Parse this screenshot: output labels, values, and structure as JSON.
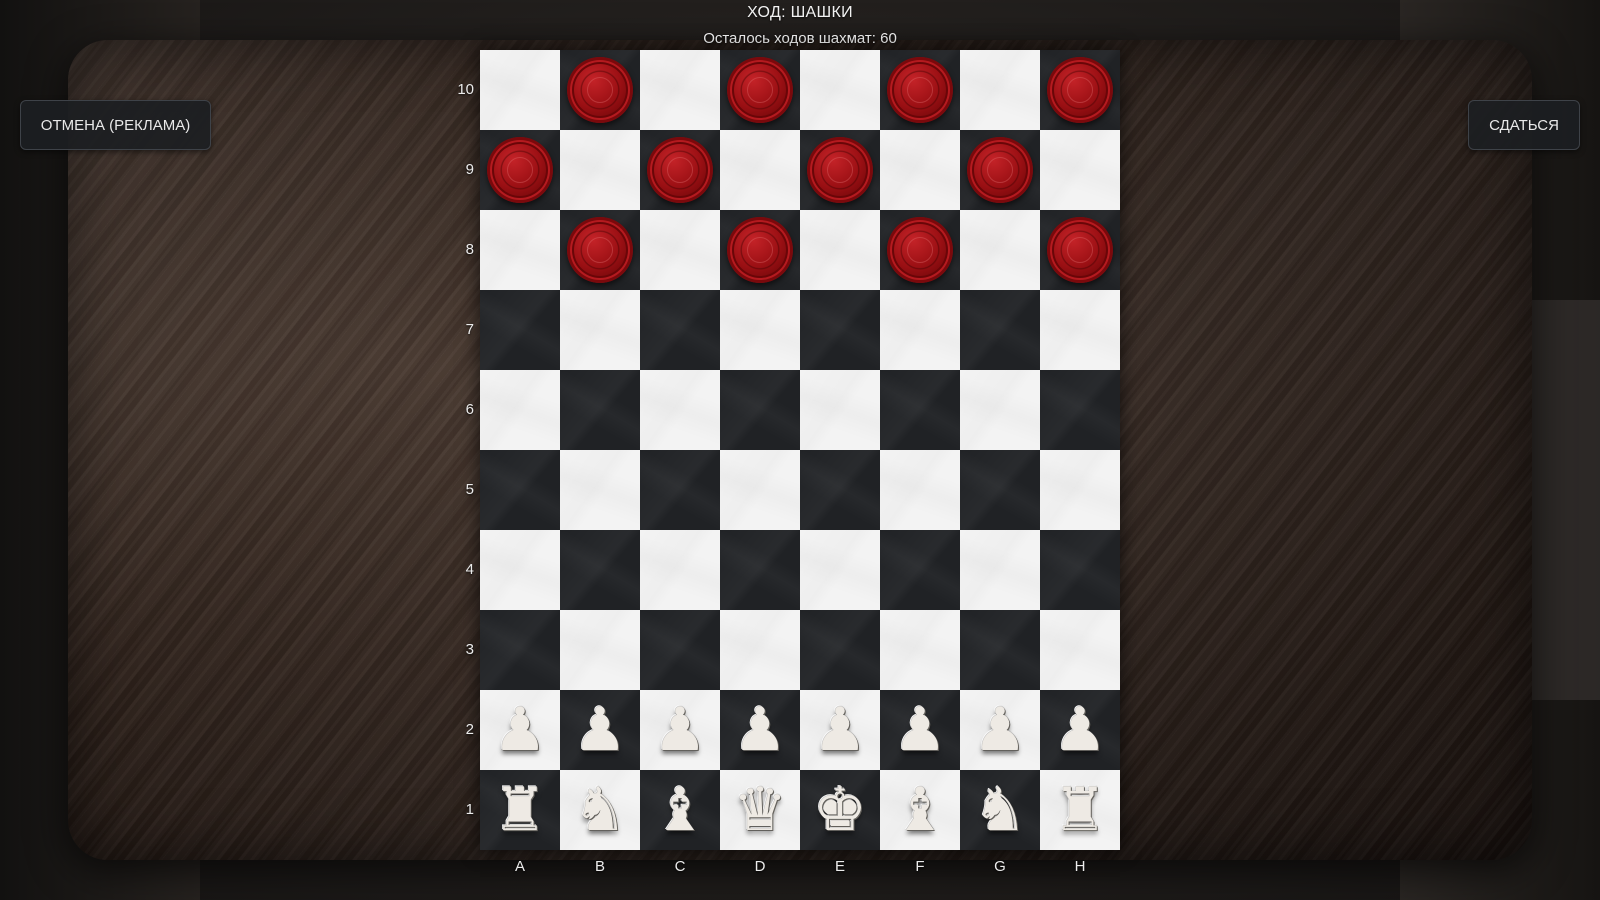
{
  "header": {
    "turn_text": "ХОД: ШАШКИ",
    "moves_left_text": "Осталось ходов шахмат: 60"
  },
  "buttons": {
    "undo_label": "ОТМЕНА (РЕКЛАМА)",
    "resign_label": "СДАТЬСЯ"
  },
  "board": {
    "files": [
      "A",
      "B",
      "C",
      "D",
      "E",
      "F",
      "G",
      "H"
    ],
    "ranks": [
      "10",
      "9",
      "8",
      "7",
      "6",
      "5",
      "4",
      "3",
      "2",
      "1"
    ],
    "rows": [
      [
        "",
        "checker",
        "",
        "checker",
        "",
        "checker",
        "",
        "checker"
      ],
      [
        "checker",
        "",
        "checker",
        "",
        "checker",
        "",
        "checker",
        ""
      ],
      [
        "",
        "checker",
        "",
        "checker",
        "",
        "checker",
        "",
        "checker"
      ],
      [
        "",
        "",
        "",
        "",
        "",
        "",
        "",
        ""
      ],
      [
        "",
        "",
        "",
        "",
        "",
        "",
        "",
        ""
      ],
      [
        "",
        "",
        "",
        "",
        "",
        "",
        "",
        ""
      ],
      [
        "",
        "",
        "",
        "",
        "",
        "",
        "",
        ""
      ],
      [
        "",
        "",
        "",
        "",
        "",
        "",
        "",
        ""
      ],
      [
        "pawn",
        "pawn",
        "pawn",
        "pawn",
        "pawn",
        "pawn",
        "pawn",
        "pawn"
      ],
      [
        "rook",
        "knight",
        "bishop",
        "queen",
        "king",
        "bishop",
        "knight",
        "rook"
      ]
    ]
  },
  "colors": {
    "checker": "#9c1014",
    "light_square": "#f3f3f3",
    "dark_square": "#202225",
    "chess_pieces": "#eeeae4"
  }
}
